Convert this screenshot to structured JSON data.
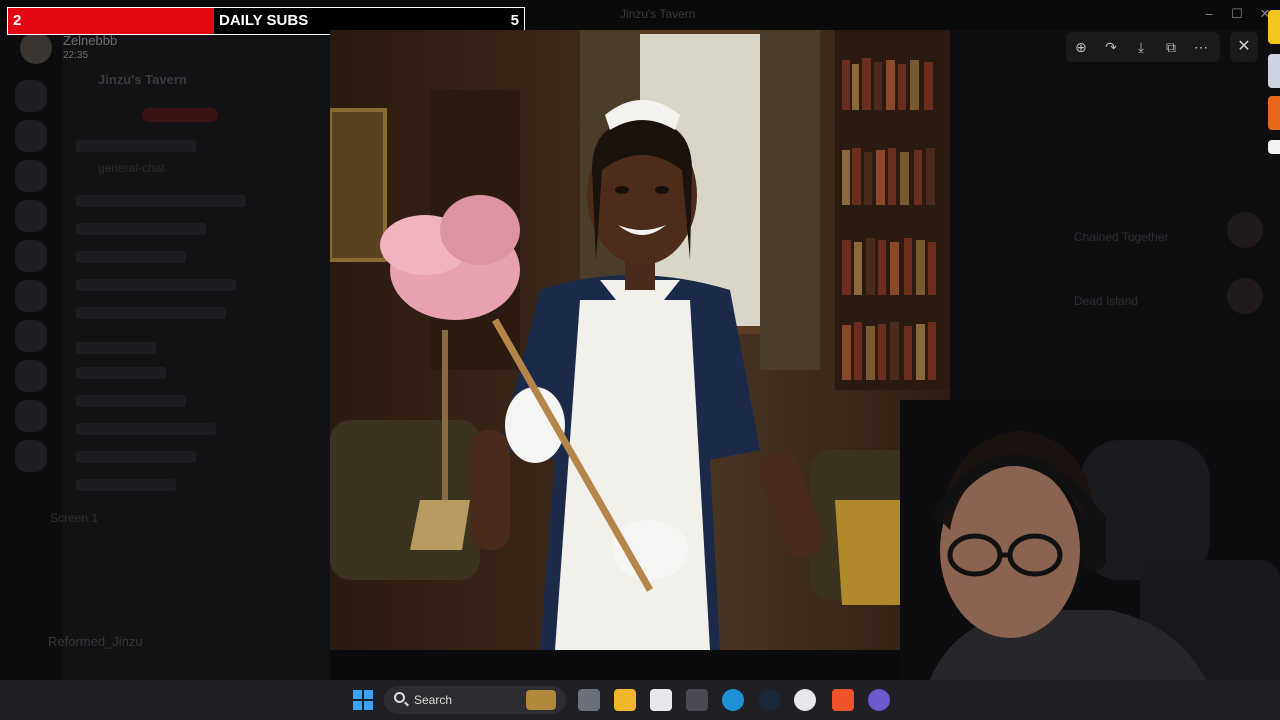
{
  "window": {
    "title": "Jinzu's Tavern"
  },
  "subs_bar": {
    "current": "2",
    "title": "DAILY SUBS",
    "goal": "5",
    "progress_fraction": 0.4
  },
  "post": {
    "username": "Zelnebbb",
    "time": "22:35"
  },
  "discord": {
    "server_name": "Jinzu's Tavern",
    "channels": [
      "general-chat"
    ],
    "screen_label": "Screen 1",
    "bottom_user": "Reformed_Jinzu"
  },
  "right_panel": {
    "items": [
      "Chained Together",
      "Dead Island"
    ]
  },
  "viewer_tools": [
    "zoom-in",
    "forward",
    "download",
    "open-external",
    "more"
  ],
  "taskbar": {
    "search_label": "Search"
  }
}
